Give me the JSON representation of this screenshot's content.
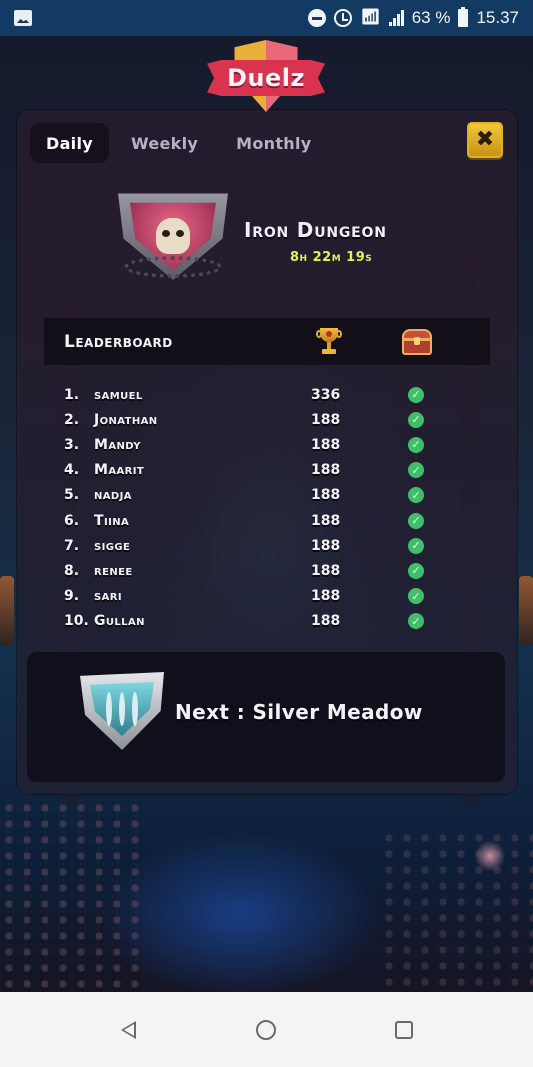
{
  "status_bar": {
    "left_icons": [
      "gallery-icon"
    ],
    "right_icons": [
      "do-not-disturb-icon",
      "alarm-icon",
      "wifi-icon",
      "signal-icon",
      "battery-icon"
    ],
    "battery_percent": "63 %",
    "time": "15.37"
  },
  "app": {
    "logo_text": "Duelz"
  },
  "tabs": [
    {
      "label": "Daily",
      "active": true
    },
    {
      "label": "Weekly",
      "active": false
    },
    {
      "label": "Monthly",
      "active": false
    }
  ],
  "close_button": {
    "icon": "close-icon",
    "glyph": "✖"
  },
  "arena": {
    "name": "Iron Dungeon",
    "timer": "8h 22m 19s",
    "badge_icon": "skull-shield-icon"
  },
  "leaderboard": {
    "title": "Leaderboard",
    "score_column_icon": "trophy-icon",
    "reward_column_icon": "chest-icon",
    "rows": [
      {
        "rank": "1.",
        "name": "samuel",
        "score": "336",
        "claimed": true
      },
      {
        "rank": "2.",
        "name": "Jonathan",
        "score": "188",
        "claimed": true
      },
      {
        "rank": "3.",
        "name": "Mandy",
        "score": "188",
        "claimed": true
      },
      {
        "rank": "4.",
        "name": "Maarit",
        "score": "188",
        "claimed": true
      },
      {
        "rank": "5.",
        "name": "nadja",
        "score": "188",
        "claimed": true
      },
      {
        "rank": "6.",
        "name": "Tiina",
        "score": "188",
        "claimed": true
      },
      {
        "rank": "7.",
        "name": "sigge",
        "score": "188",
        "claimed": true
      },
      {
        "rank": "8.",
        "name": "renee",
        "score": "188",
        "claimed": true
      },
      {
        "rank": "9.",
        "name": "sari",
        "score": "188",
        "claimed": true
      },
      {
        "rank": "10.",
        "name": "Gullan",
        "score": "188",
        "claimed": true
      }
    ],
    "check_glyph": "✓"
  },
  "next_arena": {
    "label": "Next : Silver Meadow",
    "badge_icon": "silver-shield-icon"
  },
  "nav_bar": {
    "buttons": [
      "back",
      "home",
      "recents"
    ]
  },
  "colors": {
    "status_bar": "#123a63",
    "panel": "#261c2c",
    "active_tab": "#16101c",
    "close_button": "#f3cc3a",
    "timer": "#dff25a",
    "check": "#3fbf6a",
    "logo_ribbon": "#d8334f"
  }
}
